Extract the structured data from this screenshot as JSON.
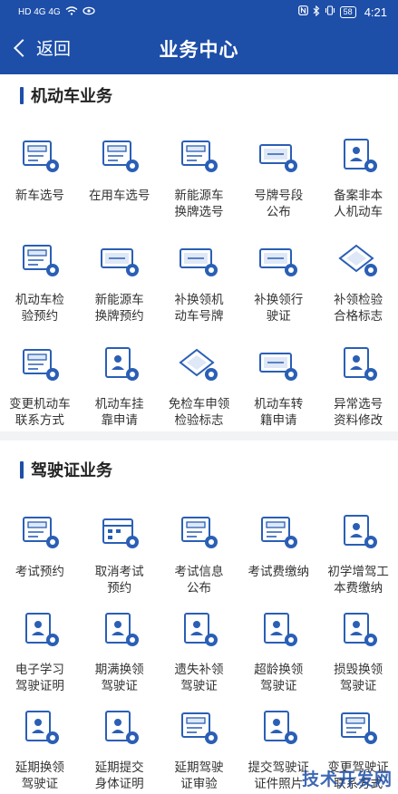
{
  "status_bar": {
    "carrier": "HD 4G 4G",
    "battery": "58",
    "time": "4:21"
  },
  "header": {
    "back_label": "返回",
    "title": "业务中心"
  },
  "vehicle_section": {
    "title": "机动车业务",
    "items": [
      {
        "label": "新车选号",
        "icon": "new-car-number-icon"
      },
      {
        "label": "在用车选号",
        "icon": "used-car-number-icon"
      },
      {
        "label": "新能源车\n换牌选号",
        "icon": "ev-plate-change-icon"
      },
      {
        "label": "号牌号段\n公布",
        "icon": "plate-range-icon"
      },
      {
        "label": "备案非本\n人机动车",
        "icon": "register-vehicle-icon"
      },
      {
        "label": "机动车检\n验预约",
        "icon": "inspection-booking-icon"
      },
      {
        "label": "新能源车\n换牌预约",
        "icon": "ev-plate-booking-icon"
      },
      {
        "label": "补换领机\n动车号牌",
        "icon": "replace-plate-icon"
      },
      {
        "label": "补换领行\n驶证",
        "icon": "replace-license-icon"
      },
      {
        "label": "补领检验\n合格标志",
        "icon": "inspection-sticker-icon"
      },
      {
        "label": "变更机动车\n联系方式",
        "icon": "change-contact-icon"
      },
      {
        "label": "机动车挂\n靠申请",
        "icon": "affiliation-icon"
      },
      {
        "label": "免检车申领\n检验标志",
        "icon": "exempt-sticker-icon"
      },
      {
        "label": "机动车转\n籍申请",
        "icon": "transfer-icon"
      },
      {
        "label": "异常选号\n资料修改",
        "icon": "abnormal-number-icon"
      }
    ]
  },
  "driver_section": {
    "title": "驾驶证业务",
    "items": [
      {
        "label": "考试预约",
        "icon": "exam-booking-icon"
      },
      {
        "label": "取消考试\n预约",
        "icon": "cancel-exam-icon"
      },
      {
        "label": "考试信息\n公布",
        "icon": "exam-info-icon"
      },
      {
        "label": "考试费缴纳",
        "icon": "exam-fee-icon"
      },
      {
        "label": "初学增驾工\n本费缴纳",
        "icon": "learner-fee-icon"
      },
      {
        "label": "电子学习\n驾驶证明",
        "icon": "e-learning-icon"
      },
      {
        "label": "期满换领\n驾驶证",
        "icon": "expiry-renew-icon"
      },
      {
        "label": "遗失补领\n驾驶证",
        "icon": "lost-replace-icon"
      },
      {
        "label": "超龄换领\n驾驶证",
        "icon": "overage-renew-icon"
      },
      {
        "label": "损毁换领\n驾驶证",
        "icon": "damaged-replace-icon"
      },
      {
        "label": "延期换领\n驾驶证",
        "icon": "defer-renew-icon"
      },
      {
        "label": "延期提交\n身体证明",
        "icon": "defer-health-icon"
      },
      {
        "label": "延期驾驶\n证审验",
        "icon": "defer-review-icon"
      },
      {
        "label": "提交驾驶证\n证件照片",
        "icon": "submit-photo-icon"
      },
      {
        "label": "变更驾驶证\n联系方式",
        "icon": "change-driver-contact-icon"
      }
    ]
  },
  "watermark": "技术开发网",
  "colors": {
    "brand": "#1d4ea8",
    "icon_blue": "#2a5fb5",
    "icon_light": "#dfe8f6"
  }
}
